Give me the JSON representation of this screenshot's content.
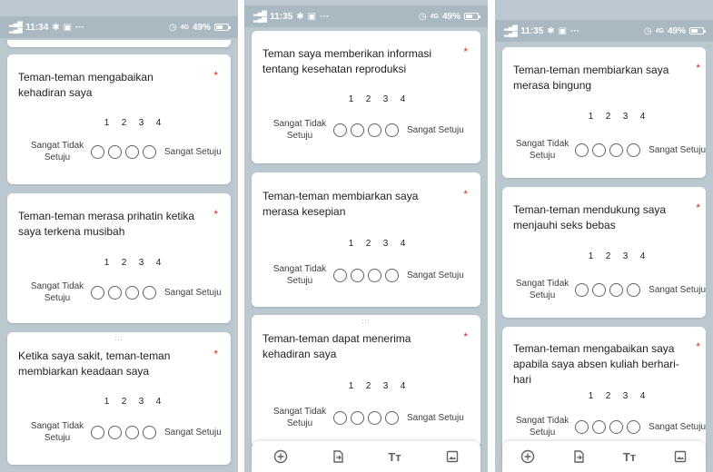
{
  "common": {
    "scale": [
      "1",
      "2",
      "3",
      "4"
    ],
    "left_label": "Sangat Tidak Setuju",
    "right_label": "Sangat Setuju",
    "required_mark": "*",
    "battery": "49%",
    "signal": "4G",
    "drag_glyph": ":::"
  },
  "screens": [
    {
      "time": "11:34",
      "questions": [
        "Teman-teman mengabaikan kehadiran saya",
        "Teman-teman merasa prihatin ketika saya terkena musibah",
        "Ketika saya sakit, teman-teman membiarkan keadaan saya"
      ]
    },
    {
      "time": "11:35",
      "questions": [
        "Teman saya memberikan informasi tentang kesehatan reproduksi",
        "Teman-teman membiarkan saya merasa kesepian",
        "Teman-teman dapat menerima kehadiran saya"
      ]
    },
    {
      "time": "11:35",
      "questions": [
        "Teman-teman membiarkan saya merasa bingung",
        "Teman-teman mendukung saya menjauhi seks bebas",
        "Teman-teman mengabaikan saya apabila saya absen kuliah berhari-hari"
      ]
    }
  ],
  "toolbar": {
    "icons": [
      "add-question-icon",
      "import-questions-icon",
      "add-title-icon",
      "add-image-icon"
    ],
    "title_glyph": "Tт"
  },
  "colors": {
    "required": "#d93025",
    "status_bar": "#aab8c2",
    "background": "#bcc8d0"
  }
}
